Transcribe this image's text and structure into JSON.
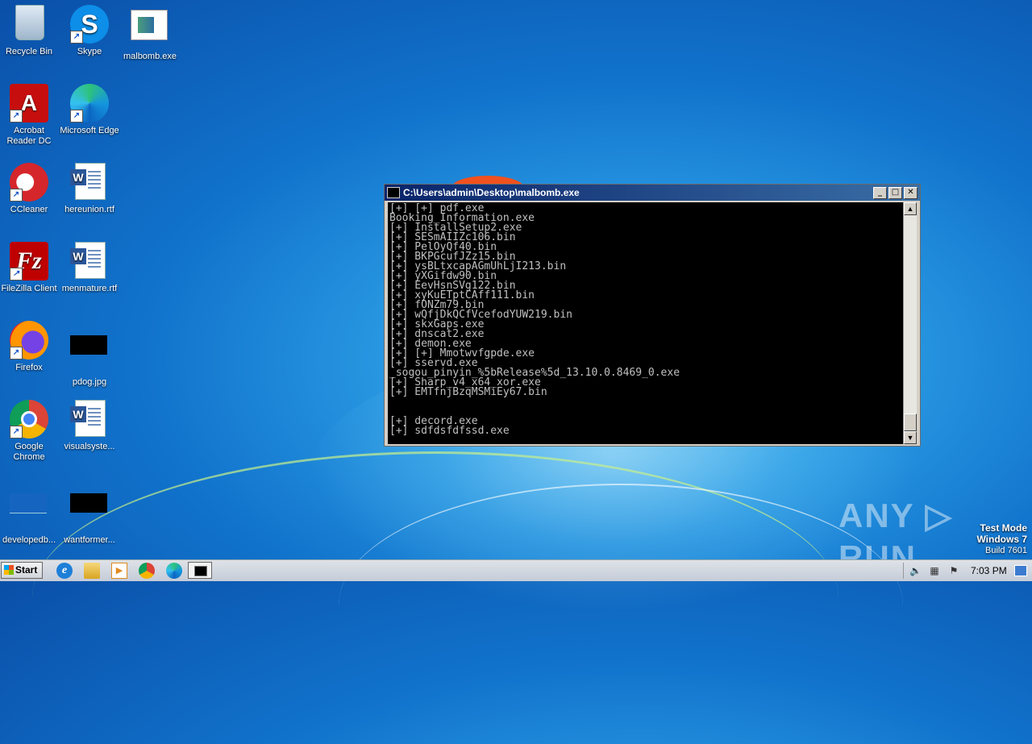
{
  "desktop": {
    "icons": [
      {
        "label": "Recycle Bin",
        "icon": "recycle-bin-icon"
      },
      {
        "label": "Skype",
        "icon": "skype-icon"
      },
      {
        "label": "malbomb.exe",
        "icon": "exe-icon"
      },
      {
        "label": "Acrobat Reader DC",
        "icon": "acrobat-icon"
      },
      {
        "label": "Microsoft Edge",
        "icon": "edge-icon"
      },
      {
        "label": "CCleaner",
        "icon": "ccleaner-icon"
      },
      {
        "label": "hereunion.rtf",
        "icon": "word-doc-icon"
      },
      {
        "label": "FileZilla Client",
        "icon": "filezilla-icon"
      },
      {
        "label": "menmature.rtf",
        "icon": "word-doc-icon"
      },
      {
        "label": "Firefox",
        "icon": "firefox-icon"
      },
      {
        "label": "pdog.jpg",
        "icon": "image-thumbnail-icon"
      },
      {
        "label": "Google Chrome",
        "icon": "chrome-icon"
      },
      {
        "label": "visualsyste...",
        "icon": "word-doc-icon"
      },
      {
        "label": "developedb...",
        "icon": "file-icon"
      },
      {
        "label": "wantformer...",
        "icon": "image-thumbnail-icon"
      }
    ]
  },
  "console": {
    "title": "C:\\Users\\admin\\Desktop\\malbomb.exe",
    "lines": [
      "[+] [+] pdf.exe",
      "Booking_Information.exe",
      "[+] InstallSetup2.exe",
      "[+] SESmAIIZc106.bin",
      "[+] PelOyQf40.bin",
      "[+] BKPGcufJZz15.bin",
      "[+] ysBLtxcapAGmUhLjI213.bin",
      "[+] yXGifdw90.bin",
      "[+] EevHsnSVg122.bin",
      "[+] xyKuETptCAff111.bin",
      "[+] fONZm79.bin",
      "[+] wQfjDkQCfVcefodYUW219.bin",
      "[+] skxGaps.exe",
      "[+] dnscat2.exe",
      "[+] demon.exe",
      "[+] [+] Mmotwvfgpde.exe",
      "[+] sservd.exe",
      "_sogou_pinyin_%5bRelease%5d_13.10.0.8469_0.exe",
      "[+] Sharp_v4_x64_xor.exe",
      "[+] EMTfnjBzqMSMiEy67.bin",
      "",
      "",
      "[+] decord.exe",
      "[+] sdfdsfdfssd.exe"
    ],
    "buttons": {
      "minimize": "_",
      "maximize": "□",
      "close": "✕"
    }
  },
  "watermark": {
    "text": "ANY ▷ RUN"
  },
  "test_mode": {
    "line1": "Test Mode",
    "line2": "Windows 7",
    "line3": "Build 7601"
  },
  "taskbar": {
    "start_label": "Start",
    "pinned": [
      "internet-explorer-icon",
      "windows-explorer-icon",
      "media-player-icon",
      "chrome-icon",
      "edge-icon",
      "console-window-icon"
    ],
    "clock": "7:03 PM"
  }
}
